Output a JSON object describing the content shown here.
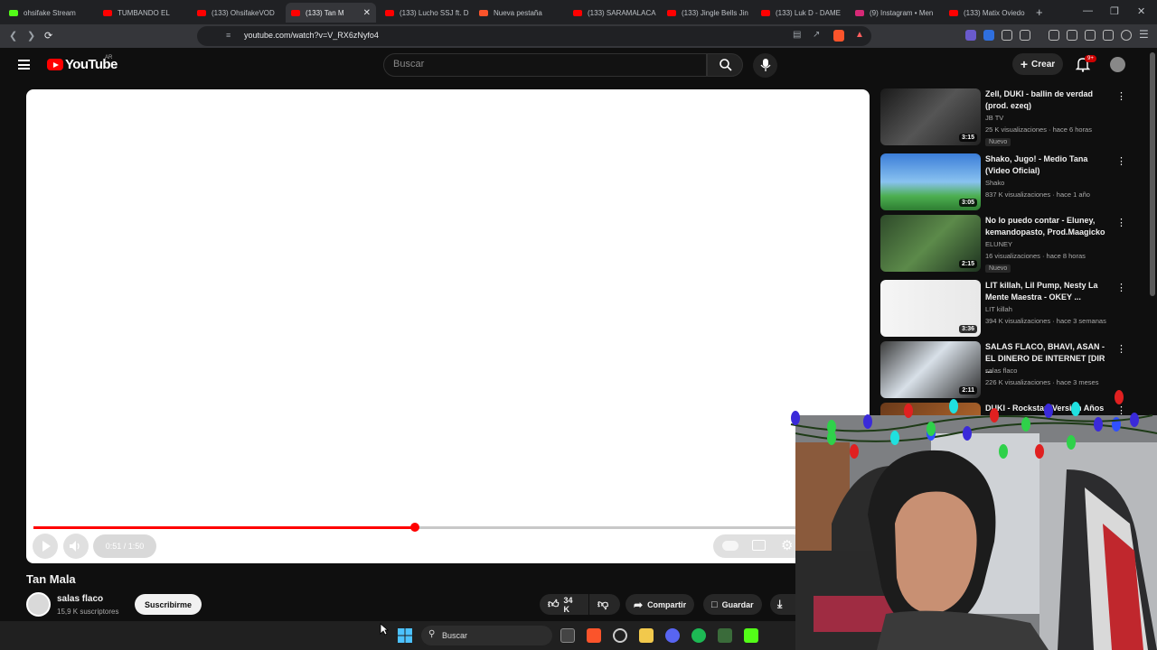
{
  "browser": {
    "tabs": [
      {
        "label": "ohsifake Stream",
        "color": "#53fc18",
        "active": false
      },
      {
        "label": "TUMBANDO EL",
        "color": "#ff0000",
        "active": false
      },
      {
        "label": "(133) OhsifakeVOD",
        "color": "#ff0000",
        "active": false
      },
      {
        "label": "(133) Tan M",
        "color": "#ff0000",
        "active": true
      },
      {
        "label": "(133) Lucho SSJ ft. D",
        "color": "#ff0000",
        "active": false
      },
      {
        "label": "Nueva pestaña",
        "color": "#fb542b",
        "active": false
      },
      {
        "label": "(133) SARAMALACA",
        "color": "#ff0000",
        "active": false
      },
      {
        "label": "(133) Jingle Bells Jin",
        "color": "#ff0000",
        "active": false
      },
      {
        "label": "(133) Luk D - DAME",
        "color": "#ff0000",
        "active": false
      },
      {
        "label": "(9) Instagram • Men",
        "color": "#d62976",
        "active": false
      },
      {
        "label": "(133) Matix Oviedo",
        "color": "#ff0000",
        "active": false
      }
    ],
    "new_tab": "+",
    "url": "youtube.com/watch?v=V_RX6zNyfo4"
  },
  "youtube": {
    "logo_text": "YouTube",
    "country": "AR",
    "search_placeholder": "Buscar",
    "create_label": "Crear",
    "notif_badge": "9+"
  },
  "player": {
    "current_time": "0:51",
    "duration": "1:50",
    "time_display": "0:51 / 1:50",
    "progress_fraction": 0.46
  },
  "video": {
    "title": "Tan Mala",
    "channel": "salas flaco",
    "subscribers": "15,9 K suscriptores",
    "subscribe_label": "Suscribirme",
    "likes": "34 K",
    "share_label": "Compartir",
    "save_label": "Guardar"
  },
  "recommendations": [
    {
      "title": "Zell, DUKI - ballin de verdad (prod. ezeq)",
      "channel": "JB TV",
      "meta": "25 K visualizaciones · hace 6 horas",
      "duration": "3:15",
      "new": "Nuevo"
    },
    {
      "title": "Shako, Jugo! - Medio Tana (Video Oficial)",
      "channel": "Shako",
      "meta": "837 K visualizaciones · hace 1 año",
      "duration": "3:05",
      "new": ""
    },
    {
      "title": "No lo puedo contar - Eluney, kemandopasto, Prod.Maagicko",
      "channel": "ELUNEY",
      "meta": "16 visualizaciones · hace 8 horas",
      "duration": "2:15",
      "new": "Nuevo"
    },
    {
      "title": "LIT killah, Lil Pump, Nesty La Mente Maestra - OKEY ...",
      "channel": "LIT killah",
      "meta": "394 K visualizaciones · hace 3 semanas",
      "duration": "3:36",
      "new": ""
    },
    {
      "title": "SALAS FLACO, BHAVI, ASAN - EL DINERO DE INTERNET [DIR ...",
      "channel": "salas flaco",
      "meta": "226 K visualizaciones · hace 3 meses",
      "duration": "2:11",
      "new": ""
    },
    {
      "title": "DUKI - Rockstar (Versión Años ... Cover)",
      "channel": "",
      "meta": "",
      "duration": "",
      "new": ""
    }
  ],
  "taskbar": {
    "search_label": "Buscar"
  }
}
